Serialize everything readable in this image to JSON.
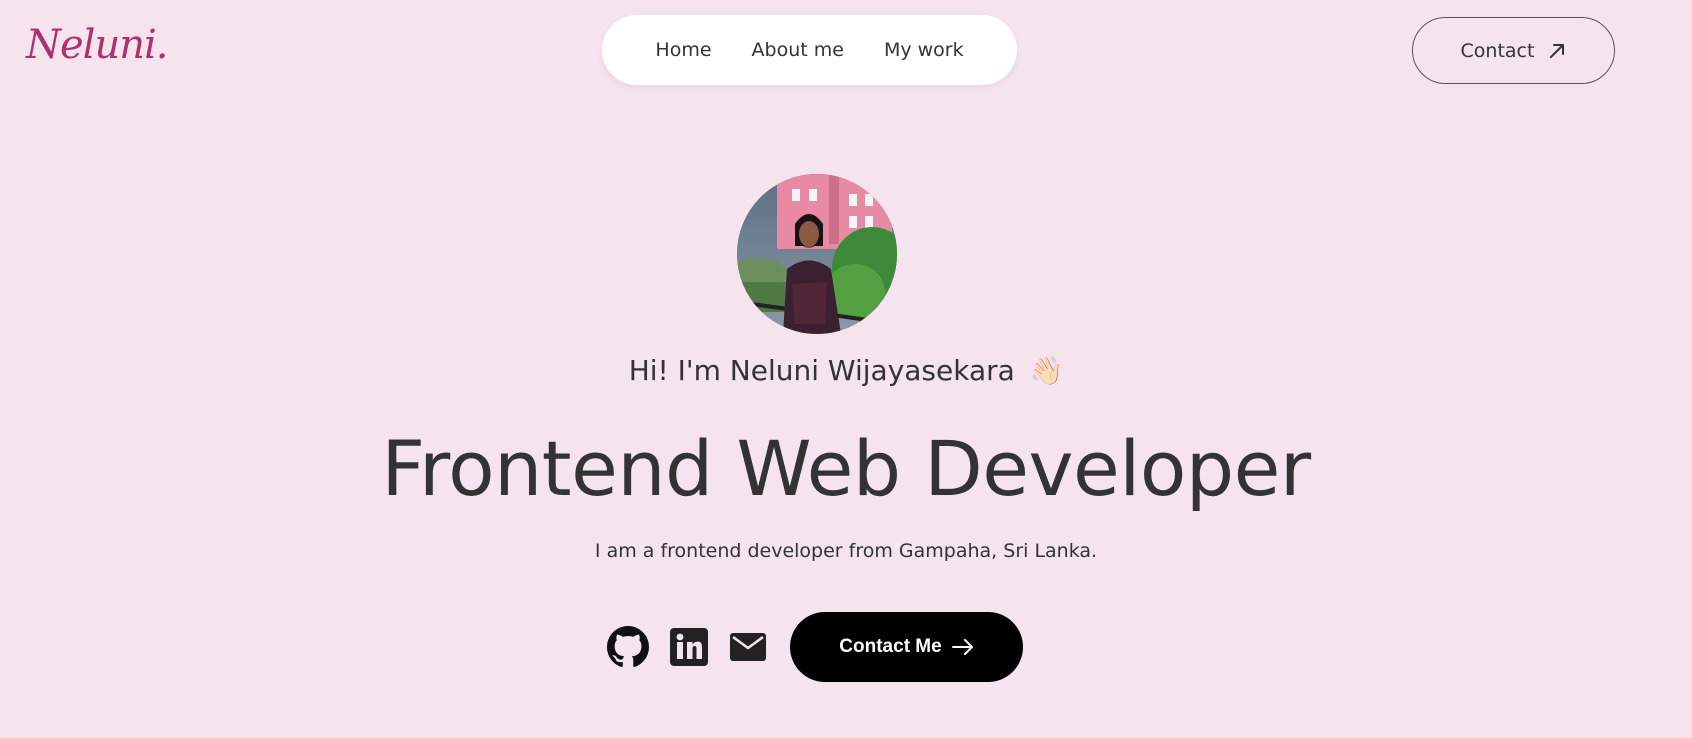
{
  "brand": {
    "logo": "Neluni."
  },
  "nav": {
    "items": [
      {
        "label": "Home"
      },
      {
        "label": "About me"
      },
      {
        "label": "My work"
      }
    ]
  },
  "header": {
    "contact_label": "Contact",
    "contact_icon": "arrow-up-right-icon"
  },
  "hero": {
    "greeting": "Hi! I'm Neluni Wijayasekara",
    "greeting_emoji": "👋🏻",
    "headline": "Frontend Web Developer",
    "tagline": "I am a frontend developer from Gampaha, Sri Lanka.",
    "avatar_alt": "profile-photo"
  },
  "social": {
    "icons": [
      "github-icon",
      "linkedin-icon",
      "mail-icon"
    ]
  },
  "cta": {
    "label": "Contact Me",
    "icon": "arrow-right-icon"
  },
  "colors": {
    "background": "#f5e4ee",
    "brand": "#b0306f",
    "text": "#333333",
    "cta_bg": "#000000"
  }
}
